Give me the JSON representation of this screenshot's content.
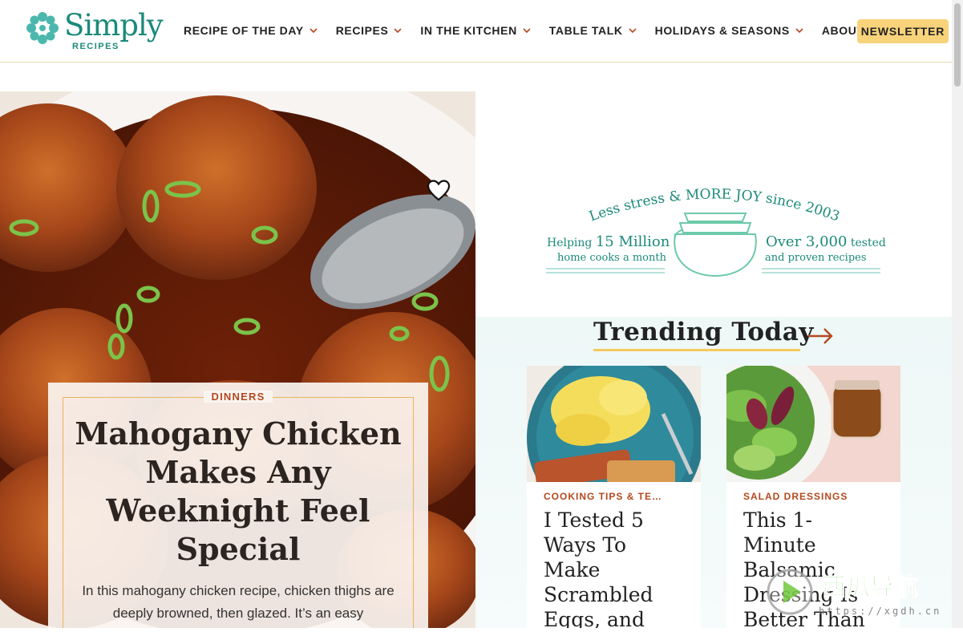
{
  "header": {
    "logo_word": "Simply",
    "logo_sub": "RECIPES",
    "nav": [
      {
        "label": "RECIPE OF THE DAY",
        "has_dropdown": true
      },
      {
        "label": "RECIPES",
        "has_dropdown": true
      },
      {
        "label": "IN THE KITCHEN",
        "has_dropdown": true
      },
      {
        "label": "TABLE TALK",
        "has_dropdown": true
      },
      {
        "label": "HOLIDAYS & SEASONS",
        "has_dropdown": true
      },
      {
        "label": "ABOUT US",
        "has_dropdown": false
      }
    ],
    "newsletter_label": "NEWSLETTER"
  },
  "hero": {
    "category": "DINNERS",
    "title": "Mahogany Chicken Makes Any Weeknight Feel Special",
    "description": "In this mahogany chicken recipe, chicken thighs are deeply browned, then glazed. It’s an easy",
    "save_icon": "heart-outline-icon"
  },
  "tagline": {
    "top": "Less stress & MORE JOY since 2003",
    "left_line1_prefix": "Helping ",
    "left_line1_big": "15 Million",
    "left_line2": "home cooks a month",
    "right_line1_big": "Over 3,000",
    "right_line1_suffix": " tested",
    "right_line2": "and proven recipes"
  },
  "trending": {
    "title": "Trending Today",
    "arrow_icon": "arrow-right-icon",
    "cards": [
      {
        "category": "COOKING TIPS & TE…",
        "title": "I Tested 5 Ways To Make Scrambled Eggs, and"
      },
      {
        "category": "SALAD DRESSINGS",
        "title": "This 1-Minute Balsamic Dressing Is Better Than"
      }
    ]
  },
  "watermark": {
    "text": "西瓜导航",
    "url": "https://xgdh.cn"
  },
  "colors": {
    "brand_teal": "#1b8a7a",
    "accent_orange": "#b4491f",
    "newsletter_yellow": "#f8d37a",
    "underline_yellow": "#f6c85f"
  }
}
